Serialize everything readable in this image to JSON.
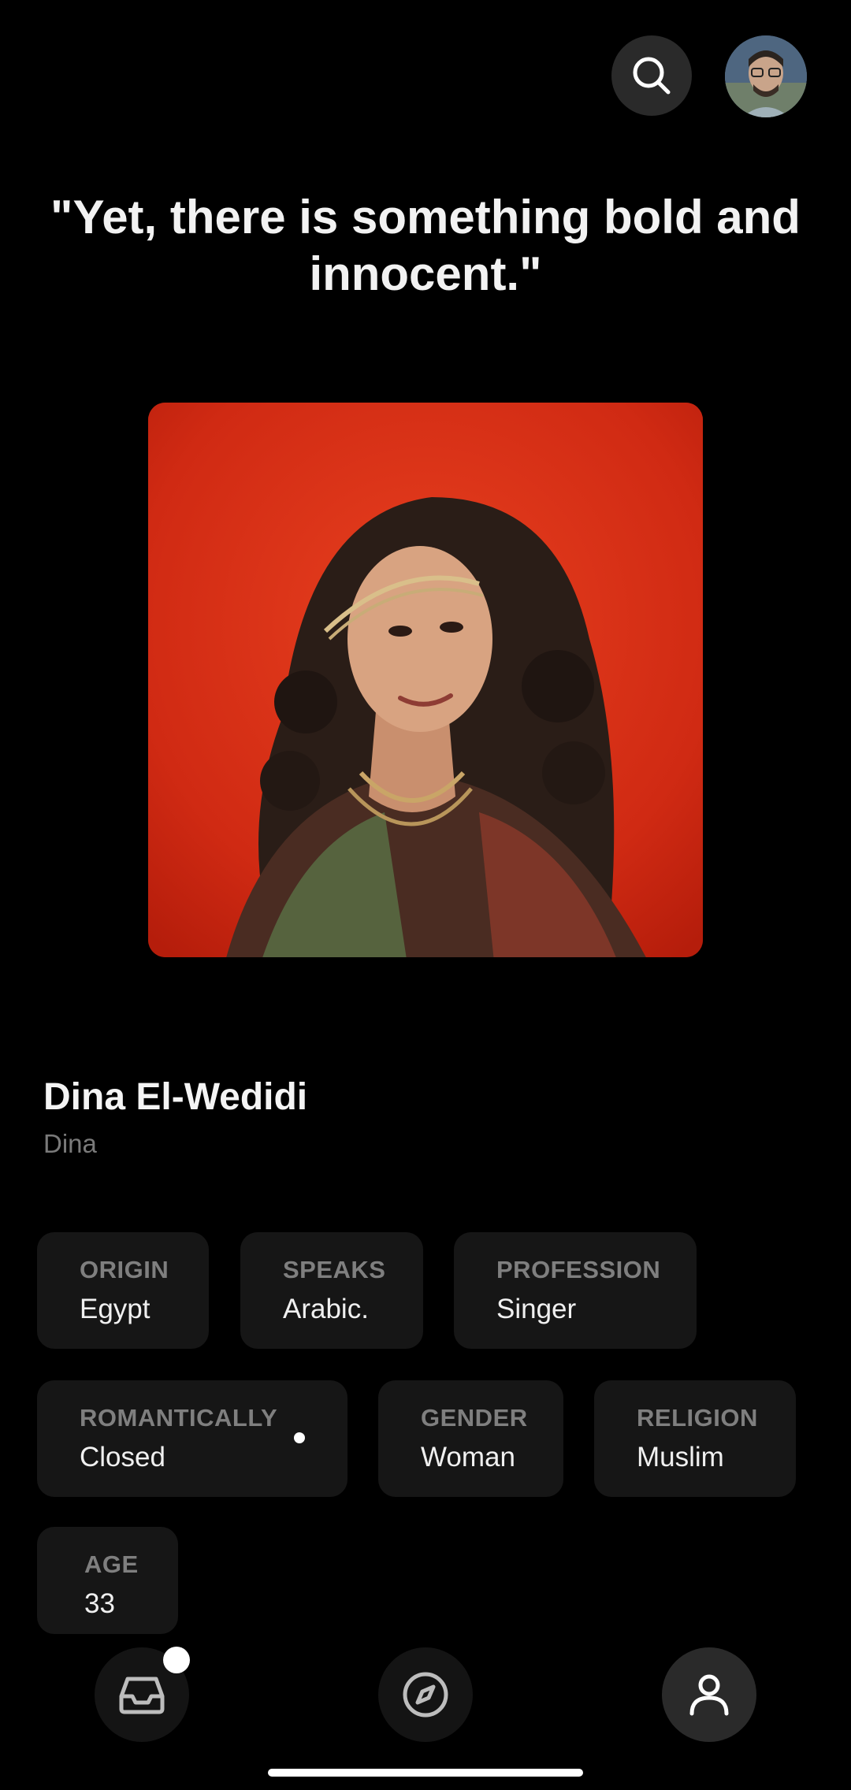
{
  "header": {
    "search_icon": "search-icon",
    "avatar": "user-avatar"
  },
  "quote": "\"Yet, there is something bold and innocent.\"",
  "profile": {
    "name": "Dina El-Wedidi",
    "nickname": "Dina"
  },
  "attributes": [
    {
      "label": "ORIGIN",
      "value": "Egypt"
    },
    {
      "label": "SPEAKS",
      "value": "Arabic."
    },
    {
      "label": "PROFESSION",
      "value": "Singer"
    },
    {
      "label": "ROMANTICALLY",
      "value": "Closed"
    },
    {
      "label": "GENDER",
      "value": "Woman"
    },
    {
      "label": "RELIGION",
      "value": "Muslim"
    },
    {
      "label": "AGE",
      "value": "33"
    }
  ],
  "bottom_nav": {
    "items": [
      "inbox-icon",
      "compass-icon",
      "profile-icon"
    ],
    "active": "profile-icon"
  },
  "colors": {
    "background": "#000000",
    "chip": "#161616",
    "portrait_background": "#d32d16"
  }
}
